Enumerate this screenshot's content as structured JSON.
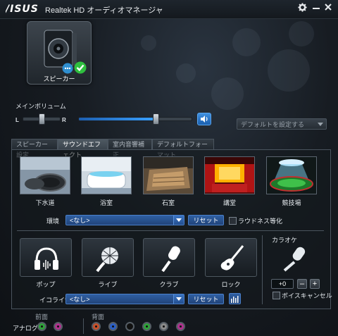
{
  "titlebar": {
    "logo": "/ISUS",
    "title": "Realtek HD オーディオマネージャ",
    "settings_icon": "gear-icon",
    "minimize_icon": "minimize-icon",
    "close_icon": "close-icon"
  },
  "device": {
    "label": "スピーカー",
    "icon": "speaker-icon",
    "badges": [
      "chat-icon",
      "check-icon"
    ]
  },
  "volume": {
    "label": "メインボリューム",
    "left_label": "L",
    "right_label": "R",
    "level": 0.68,
    "balance": 0.5
  },
  "default_dropdown": {
    "label": "デフォルトを設定する"
  },
  "tabs": [
    "スピーカー設定",
    "サウンドエフェクト",
    "室内音響補正",
    "デフォルトフォーマット"
  ],
  "active_tab": 1,
  "environments": [
    "下水道",
    "浴室",
    "石室",
    "講堂",
    "競技場"
  ],
  "environment_row": {
    "label": "環境",
    "value": "<なし>",
    "reset": "リセット",
    "loudness_label": "ラウドネス等化"
  },
  "equalizer_presets": [
    "ポップ",
    "ライブ",
    "クラブ",
    "ロック"
  ],
  "equalizer_row": {
    "label": "イコライザ",
    "value": "<なし>",
    "reset": "リセット"
  },
  "karaoke": {
    "label": "カラオケ",
    "value": "+0",
    "minus": "–",
    "plus": "+",
    "voice_cancel_label": "ボイスキャンセル"
  },
  "jacks": {
    "front_label": "前面",
    "rear_label": "背面",
    "analog_label": "アナログ",
    "front_colors": [
      "#2fa33a",
      "#b0308e"
    ],
    "rear_colors": [
      "#c7502a",
      "#2a5fc7",
      "#101010",
      "#2fa33a",
      "#8a8a8a",
      "#b0308e"
    ]
  },
  "colors": {
    "accent": "#2f6fc4",
    "check": "#2fbf3f"
  }
}
